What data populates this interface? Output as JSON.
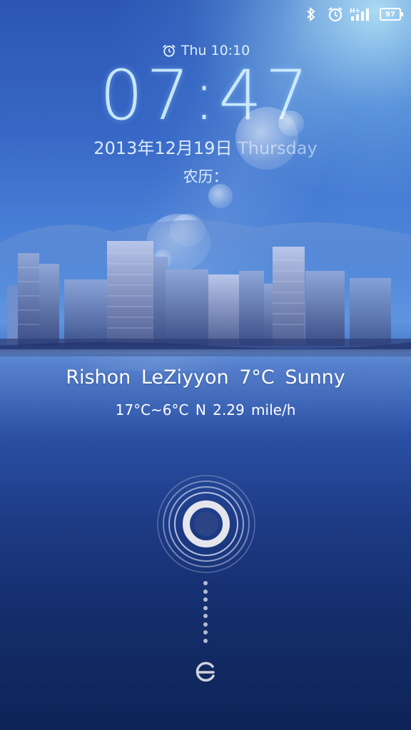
{
  "status_bar": {
    "icons": [
      "bluetooth-icon",
      "alarm-icon",
      "hplus-signal-icon"
    ],
    "battery_level": "97"
  },
  "lockscreen": {
    "alarm_label": "Thu 10:10",
    "time": "07:47",
    "date": "2013年12月19日",
    "weekday": "Thursday",
    "lunar_label": "农历："
  },
  "weather": {
    "summary": "Rishon LeZiyyon  7°C  Sunny",
    "details": "17°C~6°C  N 2.29 mile/h"
  },
  "unlock": {
    "ring_icon": "unlock-ring-icon",
    "bottom_icon": "miui-logo-icon"
  },
  "colors": {
    "accent": "#d8f0ff",
    "background_top": "#2d56b4",
    "background_bottom": "#0e2357"
  }
}
